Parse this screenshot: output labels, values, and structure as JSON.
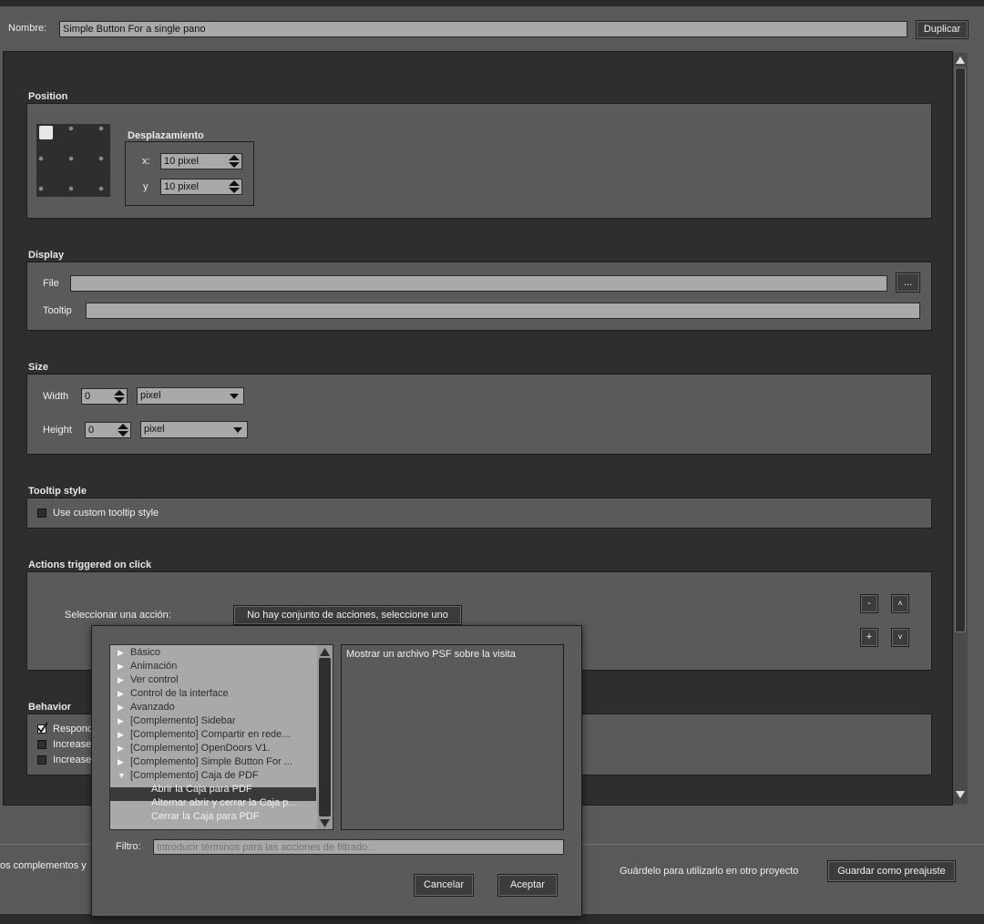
{
  "header": {
    "name_label": "Nombre:",
    "name_value": "Simple Button For a single pano",
    "duplicate_label": "Duplicar"
  },
  "position": {
    "title": "Position",
    "offset_title": "Desplazamiento",
    "x_label": "x:",
    "x_value": "10 pixel",
    "y_label": "y",
    "y_value": "10 pixel"
  },
  "display": {
    "title": "Display",
    "file_label": "File",
    "file_value": "",
    "browse_label": "...",
    "tooltip_label": "Tooltip",
    "tooltip_value": ""
  },
  "size": {
    "title": "Size",
    "width_label": "Width",
    "width_value": "0",
    "width_unit": "pixel",
    "height_label": "Height",
    "height_value": "0",
    "height_unit": "pixel"
  },
  "tooltip_style": {
    "title": "Tooltip style",
    "custom_label": "Use custom tooltip style"
  },
  "actions": {
    "title": "Actions triggered on click",
    "select_label": "Seleccionar una acción:",
    "select_button": "No hay conjunto de acciones, seleccione uno",
    "minus": "-",
    "plus": "+",
    "up": "˄",
    "down": "˅"
  },
  "behavior": {
    "title": "Behavior",
    "items": [
      "Respond",
      "Increase",
      "Increase"
    ]
  },
  "footer": {
    "left_text": "os complementos y",
    "save_hint": "Guárdelo para utilizarlo en otro proyecto",
    "save_button": "Guardar como preajuste"
  },
  "dialog": {
    "tree": [
      {
        "label": "Básico",
        "expanded": false
      },
      {
        "label": "Animación",
        "expanded": false
      },
      {
        "label": "Ver control",
        "expanded": false
      },
      {
        "label": "Control de la interface",
        "expanded": false
      },
      {
        "label": "Avanzado",
        "expanded": false
      },
      {
        "label": "[Complemento] Sidebar",
        "expanded": false
      },
      {
        "label": "[Complemento] Compartir en rede...",
        "expanded": false
      },
      {
        "label": "[Complemento] OpenDoors V1.",
        "expanded": false
      },
      {
        "label": "[Complemento] Simple Button For ...",
        "expanded": false
      },
      {
        "label": "[Complemento] Caja de PDF",
        "expanded": true
      }
    ],
    "children": [
      {
        "label": "Abrir la Caja para PDF",
        "selected": true
      },
      {
        "label": "Alternar abrir y cerrar la Caja p...",
        "selected": false
      },
      {
        "label": "Cerrar la Caja para PDF",
        "selected": false
      }
    ],
    "description": "Mostrar un archivo PSF sobre la visita",
    "filter_label": "Filtro:",
    "filter_placeholder": "Introducir términos para las acciones de filtrado...",
    "cancel_label": "Cancelar",
    "accept_label": "Aceptar"
  },
  "colors": {
    "background": "#595959",
    "panel": "#2e2e2e",
    "field": "#a9a9a9",
    "selection": "#3a3a3a"
  }
}
